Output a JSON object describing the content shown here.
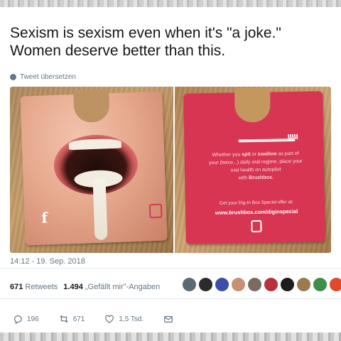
{
  "tweet": {
    "line1": "Sexism is sexism even when it's \"a joke.\"",
    "line2": "Women deserve better than this.",
    "translate_label": "Tweet übersetzen",
    "timestamp": "14:12 - 19. Sep. 2018"
  },
  "photo_right": {
    "line1a": "Whether you ",
    "line1b": "spit",
    "line1c": " or ",
    "line1d": "swallow",
    "line1e": " as part of",
    "line2": "your (twice...) daily oral regime, place your",
    "line3": "oral health on autopilot",
    "line4a": "with ",
    "line4b": "Brushbox.",
    "offer": "Get your Dig-In Box Special offer at:",
    "url": "www.brushbox.com/diginspecial"
  },
  "photo_left": {
    "logo_letter": "f"
  },
  "stats": {
    "retweets_count": "671",
    "retweets_label": "Retweets",
    "likes_count": "1.494",
    "likes_label": "„Gefällt mir\"-Angaben"
  },
  "avatars": [
    {
      "color": "#5b6b73"
    },
    {
      "color": "#2b2b2b"
    },
    {
      "color": "#3b4fa8"
    },
    {
      "color": "#c88f74"
    },
    {
      "color": "#7a6b5f"
    },
    {
      "color": "#b8323a"
    },
    {
      "color": "#1d1d1d"
    },
    {
      "color": "#9a7b4f"
    },
    {
      "color": "#3f8f4c"
    },
    {
      "color": "#e0492b"
    }
  ],
  "actions": {
    "reply_count": "196",
    "retweet_count": "671",
    "like_count": "1,5 Tsd."
  },
  "colors": {
    "accent": "#d83552",
    "text": "#14171a",
    "muted": "#657786"
  }
}
